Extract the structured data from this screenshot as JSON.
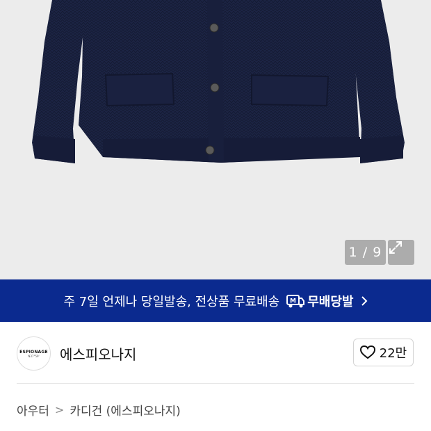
{
  "gallery": {
    "counter": "1 / 9",
    "expand_icon": "expand-icon",
    "background": "#ececec",
    "garment_color": "#1b2240"
  },
  "banner": {
    "text": "주 7일 언제나 당일발송, 전상품 무료배송",
    "badge_label": "무배당발",
    "badge_icon": "delivery-truck-icon",
    "chevron_icon": "chevron-right-icon",
    "background": "#0b2a8f"
  },
  "brand": {
    "logo_line1": "ESPIONAGE",
    "logo_line2": "N37°59'",
    "name": "에스피오나지",
    "like_icon": "heart-icon",
    "like_count": "22만"
  },
  "breadcrumb": {
    "items": [
      "아우터",
      "카디건 (에스피오나지)"
    ],
    "separator": ">"
  }
}
